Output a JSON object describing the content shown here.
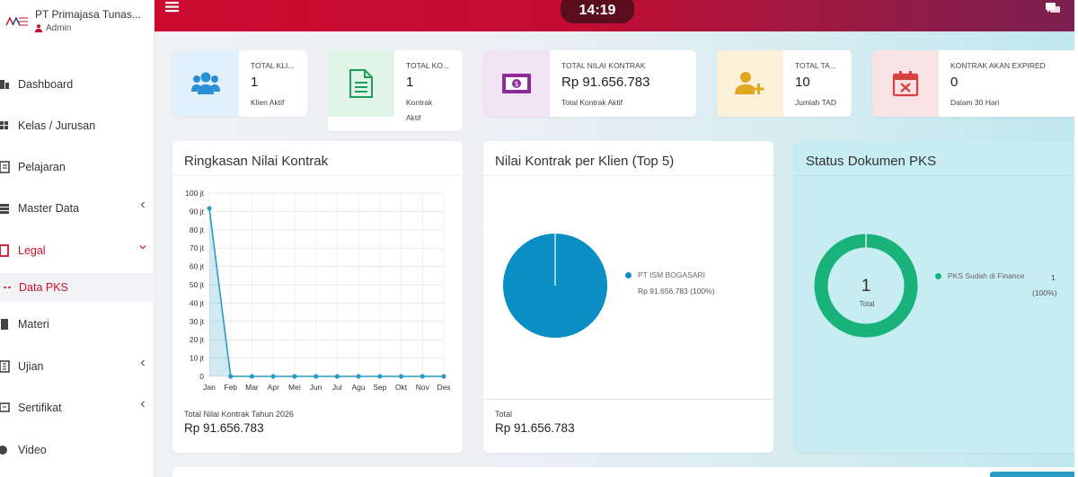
{
  "topbar": {
    "time": "14:19"
  },
  "brand": {
    "name": "PT Primajasa Tunas...",
    "role": "Admin"
  },
  "sidebar": {
    "items": [
      {
        "label": "Dashboard"
      },
      {
        "label": "Kelas / Jurusan"
      },
      {
        "label": "Pelajaran"
      },
      {
        "label": "Master Data"
      },
      {
        "label": "Legal"
      },
      {
        "label": "Data PKS"
      },
      {
        "label": "Materi"
      },
      {
        "label": "Ujian"
      },
      {
        "label": "Sertifikat"
      },
      {
        "label": "Video"
      }
    ]
  },
  "stats": [
    {
      "title": "TOTAL KLI...",
      "value": "1",
      "sub": "Klien Aktif",
      "icon": "users-icon",
      "color": "#2b8fd6"
    },
    {
      "title": "TOTAL KO...",
      "value": "1",
      "sub": "Kontrak",
      "sub2": "Aktif",
      "icon": "document-icon",
      "color": "#1e9e5a"
    },
    {
      "title": "TOTAL NILAI KONTRAK",
      "value": "Rp 91.656.783",
      "sub": "Total Kontrak Aktif",
      "icon": "money-icon",
      "color": "#8e2a9a"
    },
    {
      "title": "TOTAL TA...",
      "value": "10",
      "sub": "Jumlah TAD",
      "icon": "user-add-icon",
      "color": "#e0a81e"
    },
    {
      "title": "KONTRAK AKAN EXPIRED",
      "value": "0",
      "sub": "Dalam 30 Hari",
      "icon": "calendar-x-icon",
      "color": "#d94040"
    }
  ],
  "panels": {
    "summary": {
      "title": "Ringkasan Nilai Kontrak",
      "footer_label": "Total Nilai Kontrak Tahun 2026",
      "footer_value": "Rp 91.656.783"
    },
    "per_client": {
      "title": "Nilai Kontrak per Klien (Top 5)",
      "footer_label": "Total",
      "footer_value": "Rp 91.656.783"
    },
    "status": {
      "title": "Status Dokumen PKS"
    }
  },
  "chart_data": [
    {
      "type": "area",
      "categories": [
        "Jan",
        "Feb",
        "Mar",
        "Apr",
        "Mei",
        "Jun",
        "Jul",
        "Agu",
        "Sep",
        "Okt",
        "Nov",
        "Des"
      ],
      "values": [
        91656783,
        0,
        0,
        0,
        0,
        0,
        0,
        0,
        0,
        0,
        0,
        0
      ],
      "ylim": [
        0,
        100000000
      ],
      "yticks": [
        "100 jt",
        "90 jt",
        "80 jt",
        "70 jt",
        "60 jt",
        "50 jt",
        "40 jt",
        "30 jt",
        "20 jt",
        "10 jt",
        "0"
      ],
      "grid": true,
      "color": "#2a9bc4"
    },
    {
      "type": "pie",
      "slices": [
        {
          "name": "PT ISM BOGASARI",
          "value": 91656783,
          "label": "Rp 91.656.783 (100%)",
          "color": "#0a8ec4"
        }
      ]
    },
    {
      "type": "pie",
      "donut": true,
      "center_value": "1",
      "center_label": "Total",
      "slices": [
        {
          "name": "PKS Sudah di Finance",
          "value": 1,
          "value_label": "1",
          "percent_label": "(100%)",
          "color": "#19b27b"
        }
      ]
    }
  ]
}
